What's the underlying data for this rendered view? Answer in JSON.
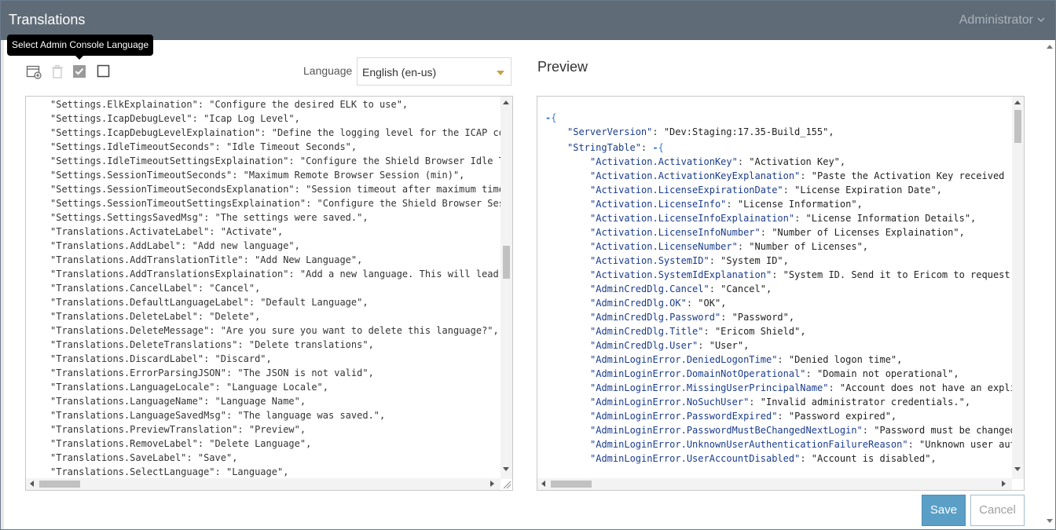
{
  "window": {
    "title": "Translations",
    "user_menu": "Administrator"
  },
  "tooltip": "Select Admin Console Language",
  "toolbar": {
    "icons": [
      "add-translation-icon",
      "delete-icon",
      "checked-checkbox-icon",
      "empty-checkbox-icon"
    ]
  },
  "language": {
    "label": "Language",
    "selected": "English (en-us)"
  },
  "preview": {
    "title": "Preview"
  },
  "editor_lines": [
    "\"Settings.ElkExplaination\": \"Configure the desired ELK to use\",",
    "\"Settings.IcapDebugLevel\": \"Icap Log Level\",",
    "\"Settings.IcapDebugLevelExplaination\": \"Define the logging level for the ICAP co",
    "\"Settings.IdleTimeoutSeconds\": \"Idle Timeout Seconds\",",
    "\"Settings.IdleTimeoutSettingsExplaination\": \"Configure the Shield Browser Idle T",
    "\"Settings.SessionTimeoutSeconds\": \"Maximum Remote Browser Session (min)\",",
    "\"Settings.SessionTimeoutSecondsExplanation\": \"Session timeout after maximum time",
    "\"Settings.SessionTimeoutSettingsExplaination\": \"Configure the Shield Browser Ses",
    "\"Settings.SettingsSavedMsg\": \"The settings were saved.\",",
    "\"Translations.ActivateLabel\": \"Activate\",",
    "\"Translations.AddLabel\": \"Add new language\",",
    "\"Translations.AddTranslationTitle\": \"Add New Language\",",
    "\"Translations.AddTranslationsExplaination\": \"Add a new language. This will lead",
    "\"Translations.CancelLabel\": \"Cancel\",",
    "\"Translations.DefaultLanguageLabel\": \"Default Language\",",
    "\"Translations.DeleteLabel\": \"Delete\",",
    "\"Translations.DeleteMessage\": \"Are you sure you want to delete this language?\",",
    "\"Translations.DeleteTranslations\": \"Delete translations\",",
    "\"Translations.DiscardLabel\": \"Discard\",",
    "\"Translations.ErrorParsingJSON\": \"The JSON is not valid\",",
    "\"Translations.LanguageLocale\": \"Language Locale\",",
    "\"Translations.LanguageName\": \"Language Name\",",
    "\"Translations.LanguageSavedMsg\": \"The language was saved.\",",
    "\"Translations.PreviewTranslation\": \"Preview\",",
    "\"Translations.RemoveLabel\": \"Delete Language\",",
    "\"Translations.SaveLabel\": \"Save\",",
    "\"Translations.SelectLanguage\": \"Language\","
  ],
  "preview_json": {
    "server_version_key": "\"ServerVersion\"",
    "server_version_value": "\"Dev:Staging:17.35-Build_155\",",
    "string_table_key": "\"StringTable\"",
    "entries": [
      [
        "\"Activation.ActivationKey\"",
        "\"Activation Key\","
      ],
      [
        "\"Activation.ActivationKeyExplanation\"",
        "\"Paste the Activation Key received"
      ],
      [
        "\"Activation.LicenseExpirationDate\"",
        "\"License Expiration Date\","
      ],
      [
        "\"Activation.LicenseInfo\"",
        "\"License Information\","
      ],
      [
        "\"Activation.LicenseInfoExplaination\"",
        "\"License Information Details\","
      ],
      [
        "\"Activation.LicenseInfoNumber\"",
        "\"Number of Licenses Explaination\","
      ],
      [
        "\"Activation.LicenseNumber\"",
        "\"Number of Licenses\","
      ],
      [
        "\"Activation.SystemID\"",
        "\"System ID\","
      ],
      [
        "\"Activation.SystemIdExplanation\"",
        "\"System ID. Send it to Ericom to request"
      ],
      [
        "\"AdminCredDlg.Cancel\"",
        "\"Cancel\","
      ],
      [
        "\"AdminCredDlg.OK\"",
        "\"OK\","
      ],
      [
        "\"AdminCredDlg.Password\"",
        "\"Password\","
      ],
      [
        "\"AdminCredDlg.Title\"",
        "\"Ericom Shield\","
      ],
      [
        "\"AdminCredDlg.User\"",
        "\"User\","
      ],
      [
        "\"AdminLoginError.DeniedLogonTime\"",
        "\"Denied logon time\","
      ],
      [
        "\"AdminLoginError.DomainNotOperational\"",
        "\"Domain not operational\","
      ],
      [
        "\"AdminLoginError.MissingUserPrincipalName\"",
        "\"Account does not have an expli"
      ],
      [
        "\"AdminLoginError.NoSuchUser\"",
        "\"Invalid administrator credentials.\","
      ],
      [
        "\"AdminLoginError.PasswordExpired\"",
        "\"Password expired\","
      ],
      [
        "\"AdminLoginError.PasswordMustBeChangedNextLogin\"",
        "\"Password must be changed"
      ],
      [
        "\"AdminLoginError.UnknownUserAuthenticationFailureReason\"",
        "\"Unknown user aut"
      ],
      [
        "\"AdminLoginError.UserAccountDisabled\"",
        "\"Account is disabled\","
      ]
    ]
  },
  "buttons": {
    "save": "Save",
    "cancel": "Cancel"
  },
  "colors": {
    "titlebar": "#5f6b76",
    "json_key": "#1a3c8c",
    "json_string": "#222222",
    "save_button": "#5b9fc7"
  }
}
